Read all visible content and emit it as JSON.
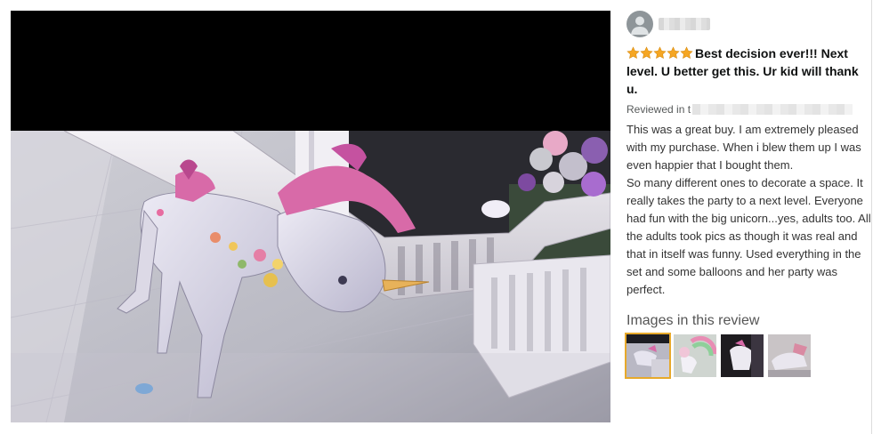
{
  "review": {
    "rating": 5,
    "rating_max": 5,
    "star_icon": "star-icon",
    "star_color": "#f5a623",
    "title": "Best decision ever!!! Next level. U better get this. Ur kid will thank u.",
    "reviewed_in_prefix": "Reviewed in t",
    "body_paragraphs": [
      "This was a great buy. I am extremely pleased with my purchase. When i blew them up I was even happier that I bought them.",
      "So many different ones to decorate a space. It really takes the party to a next level. Everyone had fun with the big unicorn...yes, adults too. All the adults took pics as though it was real and that in itself was funny. Used everything in the set and some balloons and her party was perfect."
    ],
    "images_heading": "Images in this review",
    "selected_thumbnail": 1,
    "thumbnail_count": 4,
    "accent_color": "#e7a92b"
  }
}
